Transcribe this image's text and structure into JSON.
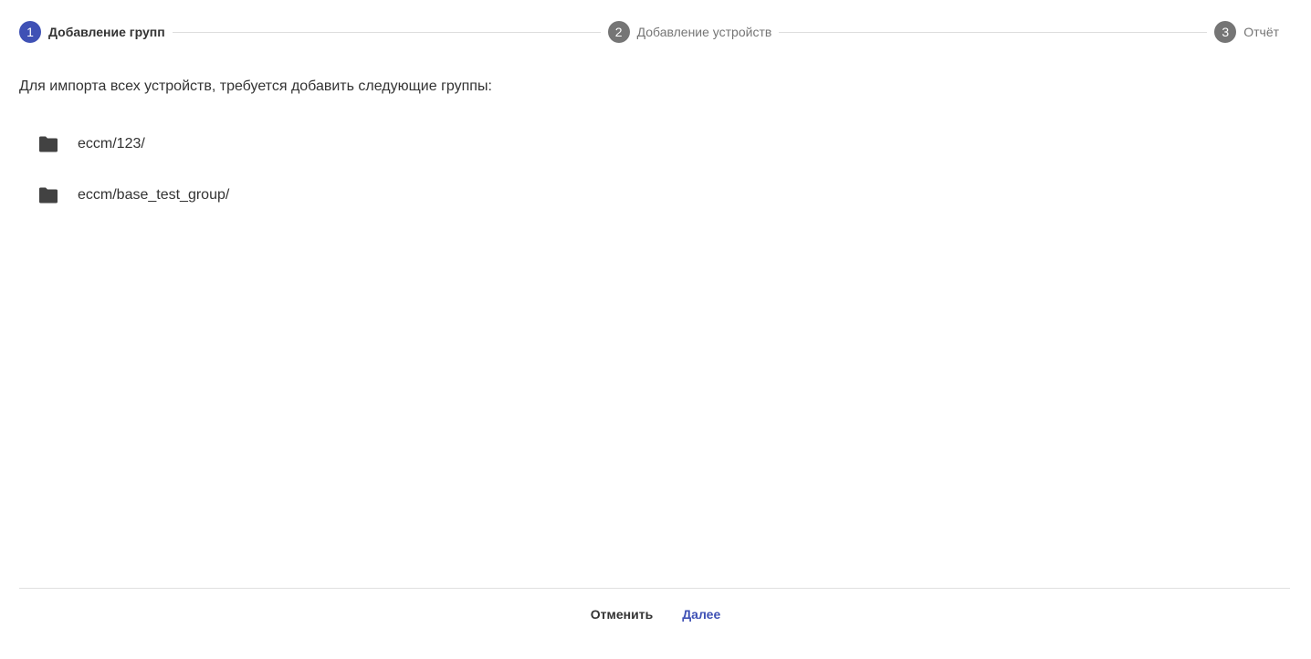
{
  "stepper": {
    "steps": [
      {
        "number": "1",
        "label": "Добавление групп",
        "state": "active"
      },
      {
        "number": "2",
        "label": "Добавление устройств",
        "state": "inactive"
      },
      {
        "number": "3",
        "label": "Отчёт",
        "state": "inactive"
      }
    ]
  },
  "content": {
    "intro": "Для импорта всех устройств, требуется добавить следующие группы:",
    "groups": [
      {
        "icon": "folder-icon",
        "label": "eccm/123/"
      },
      {
        "icon": "folder-icon",
        "label": "eccm/base_test_group/"
      }
    ]
  },
  "footer": {
    "cancel_label": "Отменить",
    "next_label": "Далее"
  },
  "colors": {
    "accent": "#3f51b5",
    "inactive_step": "#757575",
    "text": "#333333",
    "icon": "#424242"
  }
}
